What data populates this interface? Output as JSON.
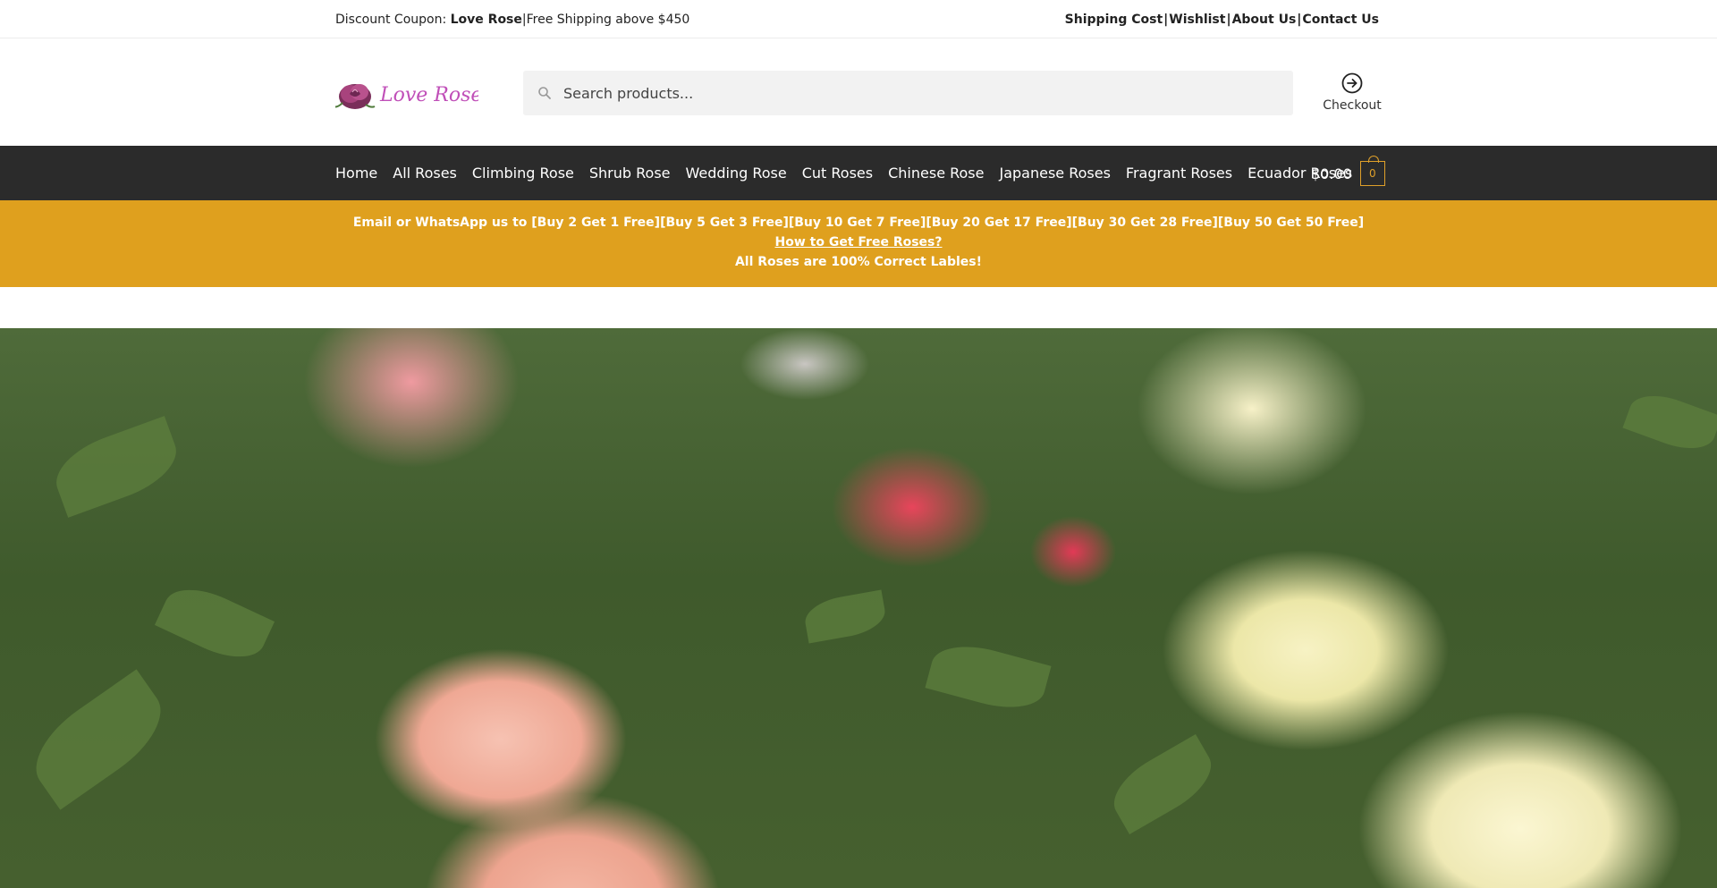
{
  "topbar": {
    "coupon_prefix": "Discount Coupon: ",
    "coupon_code": "Love Rose",
    "separator": "|",
    "shipping_note": "Free Shipping above $450",
    "links": [
      "Shipping Cost",
      "Wishlist",
      "About Us",
      "Contact Us"
    ]
  },
  "header": {
    "logo_text": "Love Rose",
    "search_placeholder": "Search products...",
    "checkout_label": "Checkout"
  },
  "nav": {
    "items": [
      "Home",
      "All Roses",
      "Climbing Rose",
      "Shrub Rose",
      "Wedding Rose",
      "Cut Roses",
      "Chinese Rose",
      "Japanese Roses",
      "Fragrant Roses",
      "Ecuador Roses"
    ],
    "cart_total": "$0.00",
    "cart_count": "0"
  },
  "promo": {
    "line1": "Email or WhatsApp us to [Buy 2  Get 1 Free][Buy 5 Get 3 Free][Buy 10 Get 7 Free][Buy 20 Get 17 Free][Buy 30 Get 28 Free][Buy 50 Get 50 Free]",
    "link": "How to Get Free Roses?",
    "line3": "All Roses are 100% Correct Lables!"
  },
  "colors": {
    "accent": "#dfa01e",
    "nav_bg": "#2b2b2b",
    "logo_text": "#c04fb8"
  }
}
